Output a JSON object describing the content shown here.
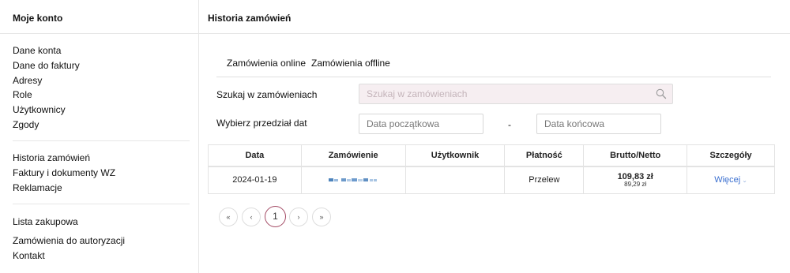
{
  "sidebar": {
    "title": "Moje konto",
    "groups": [
      [
        "Dane konta",
        "Dane do faktury",
        "Adresy",
        "Role",
        "Użytkownicy",
        "Zgody"
      ],
      [
        "Historia zamówień",
        "Faktury i dokumenty WZ",
        "Reklamacje"
      ],
      [
        "Lista zakupowa",
        "Zamówienia do autoryzacji",
        "Kontakt"
      ]
    ]
  },
  "main": {
    "title": "Historia zamówień",
    "tabs": [
      "Zamówienia online",
      "Zamówienia offline"
    ],
    "search": {
      "label": "Szukaj w zamówieniach",
      "placeholder": "Szukaj w zamówieniach",
      "icon": "search-icon"
    },
    "date_range": {
      "label": "Wybierz przedział dat",
      "from_placeholder": "Data początkowa",
      "separator": "-",
      "to_placeholder": "Data końcowa"
    },
    "table": {
      "headers": [
        "Data",
        "Zamówienie",
        "Użytkownik",
        "Płatność",
        "Brutto/Netto",
        "Szczegóły"
      ],
      "rows": [
        {
          "date": "2024-01-19",
          "order": "",
          "user": "",
          "payment": "Przelew",
          "brutto": "109,83 zł",
          "netto": "89,29 zł",
          "details": "Więcej",
          "details_icon": "chevron-down-icon"
        }
      ]
    },
    "pagination": {
      "first": "«",
      "prev": "‹",
      "current": "1",
      "next": "›",
      "last": "»"
    }
  },
  "colors": {
    "accent": "#a34a64",
    "link": "#3a6fd0",
    "search_bg": "#f6eef1",
    "border": "#e3e3e3"
  }
}
